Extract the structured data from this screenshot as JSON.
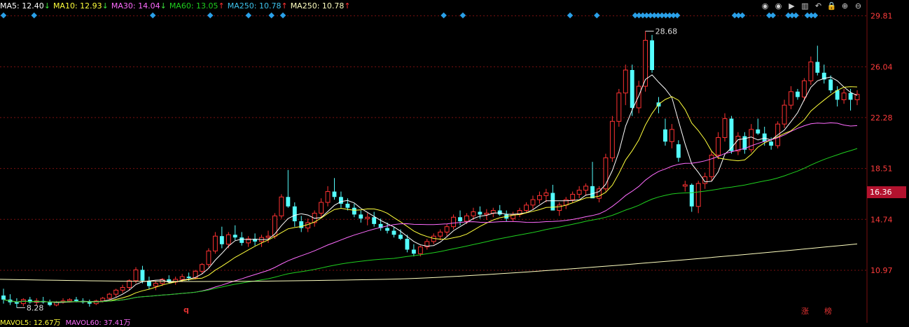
{
  "ma_legend": [
    {
      "label": "MA5: ",
      "value": "12.40",
      "arrow": "↓",
      "color": "#ffffff"
    },
    {
      "label": "MA10: ",
      "value": "12.93",
      "arrow": "↓",
      "color": "#ffff3c"
    },
    {
      "label": "MA30: ",
      "value": "14.04",
      "arrow": "↓",
      "color": "#ff6cff"
    },
    {
      "label": "MA60: ",
      "value": "13.05",
      "arrow": "↑",
      "color": "#1fcf1f"
    },
    {
      "label": "MA250: ",
      "value": "10.78",
      "arrow": "↑",
      "color": "#3ec3ec"
    },
    {
      "label": "MA250: ",
      "value": "10.78",
      "arrow": "↑",
      "color": "#ffffc0"
    }
  ],
  "toolbar": {
    "icons": [
      "eye-icon",
      "eye-icon",
      "play-icon",
      "bars-icon",
      "undo-icon",
      "lock-icon",
      "plus-icon",
      "minus-icon"
    ],
    "glyphs": [
      "◉",
      "◉",
      "▶",
      "▥",
      "↶",
      "🔒",
      "⊕",
      "⊖"
    ]
  },
  "current_price": "16.36",
  "annotations": {
    "high": "28.68",
    "low": "8.28"
  },
  "mavol": {
    "text1": "MAVOL5: 12.67万",
    "text2": "MAVOL60: 37.41万"
  },
  "tags": {
    "q": "q",
    "zhang": "涨",
    "bang": "榜"
  },
  "colors": {
    "up": "#ff3232",
    "down": "#54ffff",
    "grid": "#7a1010",
    "axis_text": "#ff3c3c",
    "ma5": "#ffffff",
    "ma10": "#ffff3c",
    "ma30": "#ff6cff",
    "ma60": "#1fcf1f",
    "ma250": "#ffffc0"
  },
  "chart_data": {
    "type": "candlestick",
    "y_ticks": [
      29.81,
      26.04,
      22.28,
      18.51,
      14.74,
      10.97
    ],
    "ylim": [
      7.6,
      30.0
    ],
    "candles": [
      [
        9.1,
        9.6,
        8.5,
        8.8
      ],
      [
        8.8,
        9.2,
        8.4,
        8.6
      ],
      [
        8.6,
        8.9,
        8.2,
        8.5
      ],
      [
        8.5,
        8.9,
        8.3,
        8.8
      ],
      [
        8.8,
        9.0,
        8.5,
        8.6
      ],
      [
        8.6,
        8.9,
        8.4,
        8.7
      ],
      [
        8.7,
        9.0,
        8.5,
        8.6
      ],
      [
        8.6,
        8.8,
        8.3,
        8.4
      ],
      [
        8.4,
        8.7,
        8.3,
        8.6
      ],
      [
        8.6,
        8.9,
        8.5,
        8.7
      ],
      [
        8.7,
        8.9,
        8.6,
        8.8
      ],
      [
        8.8,
        9.0,
        8.6,
        8.7
      ],
      [
        8.7,
        8.9,
        8.5,
        8.6
      ],
      [
        8.6,
        8.8,
        8.28,
        8.5
      ],
      [
        8.5,
        8.8,
        8.4,
        8.7
      ],
      [
        8.7,
        9.0,
        8.6,
        8.9
      ],
      [
        8.9,
        9.3,
        8.8,
        9.2
      ],
      [
        9.2,
        9.6,
        9.0,
        9.5
      ],
      [
        9.5,
        9.9,
        9.3,
        9.7
      ],
      [
        9.7,
        10.3,
        9.5,
        10.2
      ],
      [
        10.2,
        11.2,
        10.0,
        11.0
      ],
      [
        11.0,
        11.3,
        10.0,
        10.2
      ],
      [
        10.2,
        10.5,
        9.6,
        9.8
      ],
      [
        9.8,
        10.2,
        9.5,
        10.0
      ],
      [
        10.0,
        10.4,
        9.8,
        10.3
      ],
      [
        10.3,
        10.6,
        10.0,
        10.1
      ],
      [
        10.1,
        10.5,
        9.9,
        10.3
      ],
      [
        10.3,
        10.7,
        10.1,
        10.5
      ],
      [
        10.5,
        10.8,
        10.2,
        10.4
      ],
      [
        10.4,
        11.0,
        10.3,
        10.9
      ],
      [
        10.9,
        11.5,
        10.7,
        11.4
      ],
      [
        11.4,
        12.6,
        11.2,
        12.4
      ],
      [
        12.4,
        13.8,
        12.2,
        13.5
      ],
      [
        13.5,
        14.2,
        12.6,
        12.9
      ],
      [
        12.9,
        13.8,
        12.6,
        13.6
      ],
      [
        13.6,
        14.3,
        13.2,
        13.4
      ],
      [
        13.4,
        13.8,
        12.8,
        13.0
      ],
      [
        13.0,
        13.5,
        12.7,
        13.3
      ],
      [
        13.3,
        13.7,
        12.8,
        13.1
      ],
      [
        13.1,
        13.6,
        12.7,
        13.4
      ],
      [
        13.4,
        13.9,
        13.0,
        13.5
      ],
      [
        13.5,
        15.2,
        13.3,
        15.0
      ],
      [
        15.0,
        16.6,
        14.8,
        16.4
      ],
      [
        16.4,
        18.4,
        15.6,
        15.7
      ],
      [
        15.7,
        16.0,
        14.2,
        14.6
      ],
      [
        14.6,
        15.0,
        13.8,
        14.1
      ],
      [
        14.1,
        14.8,
        13.8,
        14.5
      ],
      [
        14.5,
        15.4,
        14.2,
        15.2
      ],
      [
        15.2,
        16.3,
        14.9,
        16.0
      ],
      [
        16.0,
        17.2,
        15.7,
        16.8
      ],
      [
        16.8,
        17.8,
        16.2,
        16.4
      ],
      [
        16.4,
        16.8,
        15.6,
        15.9
      ],
      [
        15.9,
        16.3,
        15.4,
        15.6
      ],
      [
        15.6,
        15.9,
        14.9,
        15.1
      ],
      [
        15.1,
        15.4,
        14.5,
        14.8
      ],
      [
        14.8,
        15.2,
        14.3,
        14.9
      ],
      [
        14.9,
        15.3,
        14.2,
        14.4
      ],
      [
        14.4,
        14.8,
        13.9,
        14.1
      ],
      [
        14.1,
        14.5,
        13.7,
        13.9
      ],
      [
        13.9,
        14.2,
        13.4,
        13.6
      ],
      [
        13.6,
        14.0,
        13.2,
        13.3
      ],
      [
        13.3,
        13.6,
        12.3,
        12.5
      ],
      [
        12.5,
        12.9,
        12.0,
        12.2
      ],
      [
        12.2,
        12.8,
        12.0,
        12.7
      ],
      [
        12.7,
        13.3,
        12.5,
        13.1
      ],
      [
        13.1,
        13.7,
        12.9,
        13.5
      ],
      [
        13.5,
        14.0,
        13.2,
        13.8
      ],
      [
        13.8,
        14.4,
        13.5,
        14.2
      ],
      [
        14.2,
        15.1,
        14.0,
        14.9
      ],
      [
        14.9,
        15.4,
        14.3,
        14.6
      ],
      [
        14.6,
        15.2,
        14.4,
        15.0
      ],
      [
        15.0,
        15.6,
        14.7,
        15.3
      ],
      [
        15.3,
        15.7,
        14.8,
        15.1
      ],
      [
        15.1,
        15.5,
        14.7,
        15.2
      ],
      [
        15.2,
        15.6,
        14.9,
        15.4
      ],
      [
        15.4,
        15.8,
        15.0,
        15.1
      ],
      [
        15.1,
        15.4,
        14.6,
        14.8
      ],
      [
        14.8,
        15.3,
        14.6,
        15.1
      ],
      [
        15.1,
        15.6,
        14.9,
        15.4
      ],
      [
        15.4,
        16.0,
        15.2,
        15.8
      ],
      [
        15.8,
        16.5,
        15.5,
        16.2
      ],
      [
        16.2,
        16.8,
        15.9,
        16.5
      ],
      [
        16.5,
        17.0,
        16.0,
        16.7
      ],
      [
        16.7,
        17.3,
        16.2,
        15.4
      ],
      [
        15.4,
        16.0,
        15.0,
        15.8
      ],
      [
        15.8,
        16.4,
        15.5,
        16.2
      ],
      [
        16.2,
        16.8,
        16.0,
        16.6
      ],
      [
        16.6,
        17.2,
        16.3,
        16.9
      ],
      [
        16.9,
        17.4,
        16.5,
        17.2
      ],
      [
        17.2,
        19.0,
        17.0,
        16.3
      ],
      [
        16.3,
        17.2,
        16.0,
        17.0
      ],
      [
        17.0,
        19.6,
        16.8,
        19.3
      ],
      [
        19.3,
        22.4,
        19.0,
        22.0
      ],
      [
        22.0,
        24.4,
        21.6,
        24.1
      ],
      [
        24.1,
        26.2,
        23.2,
        25.8
      ],
      [
        25.8,
        26.2,
        22.4,
        23.0
      ],
      [
        23.0,
        25.0,
        22.6,
        24.6
      ],
      [
        24.6,
        28.68,
        24.2,
        28.0
      ],
      [
        28.0,
        28.4,
        25.6,
        25.8
      ],
      [
        23.4,
        23.8,
        22.6,
        23.1
      ],
      [
        21.4,
        22.2,
        20.2,
        20.5
      ],
      [
        20.5,
        21.8,
        20.0,
        21.4
      ],
      [
        20.3,
        20.6,
        19.0,
        19.3
      ],
      [
        17.2,
        17.6,
        16.8,
        17.3
      ],
      [
        17.3,
        17.4,
        15.3,
        15.7
      ],
      [
        15.7,
        17.6,
        15.2,
        17.4
      ],
      [
        17.4,
        18.2,
        17.0,
        17.9
      ],
      [
        17.9,
        19.8,
        17.6,
        19.5
      ],
      [
        19.5,
        21.2,
        19.2,
        20.8
      ],
      [
        20.8,
        22.6,
        20.5,
        22.2
      ],
      [
        22.2,
        22.4,
        19.6,
        19.8
      ],
      [
        19.8,
        21.2,
        19.5,
        20.9
      ],
      [
        20.9,
        21.2,
        19.6,
        19.9
      ],
      [
        19.9,
        21.8,
        19.7,
        21.4
      ],
      [
        21.4,
        22.2,
        21.0,
        21.1
      ],
      [
        21.1,
        21.6,
        20.2,
        20.5
      ],
      [
        20.5,
        20.8,
        19.9,
        20.2
      ],
      [
        20.2,
        22.0,
        20.0,
        21.8
      ],
      [
        21.8,
        23.6,
        21.5,
        23.2
      ],
      [
        23.2,
        24.6,
        22.9,
        24.2
      ],
      [
        24.2,
        24.4,
        23.6,
        23.8
      ],
      [
        23.8,
        25.2,
        23.5,
        25.0
      ],
      [
        25.0,
        26.8,
        24.7,
        26.4
      ],
      [
        26.4,
        27.6,
        25.4,
        25.6
      ],
      [
        25.6,
        26.2,
        24.8,
        25.1
      ],
      [
        25.1,
        25.4,
        24.1,
        24.3
      ],
      [
        24.3,
        24.6,
        23.1,
        23.6
      ],
      [
        23.6,
        24.4,
        23.3,
        24.1
      ],
      [
        24.1,
        24.4,
        22.8,
        23.6
      ],
      [
        23.6,
        24.3,
        23.2,
        24.0
      ]
    ],
    "ma250_start": 10.3,
    "ma250_end": 12.92
  }
}
